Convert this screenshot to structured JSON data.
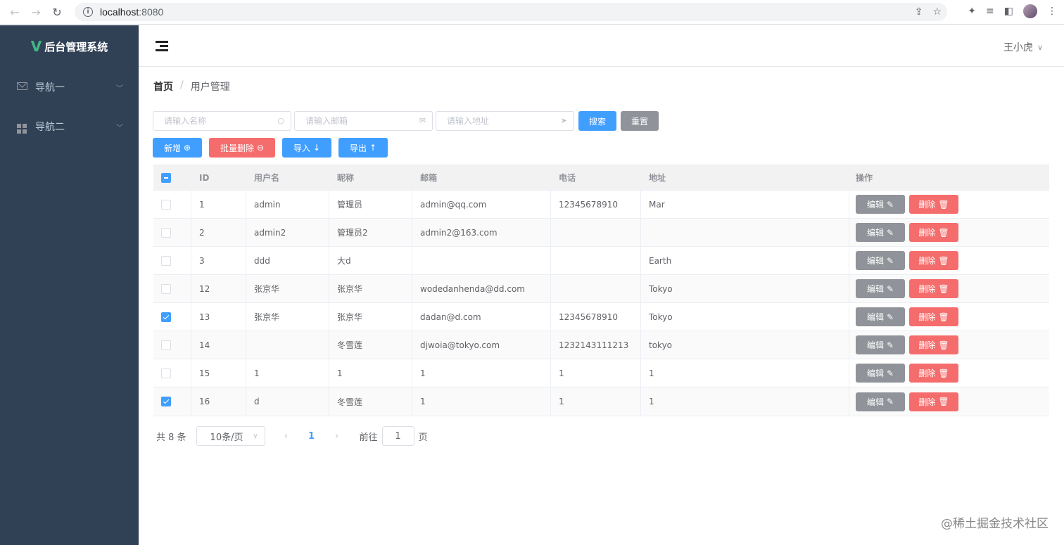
{
  "browser": {
    "url_host": "localhost",
    "url_port": ":8080"
  },
  "sidebar": {
    "logo_text": "后台管理系统",
    "items": [
      {
        "label": "导航一",
        "icon": "envelope-icon"
      },
      {
        "label": "导航二",
        "icon": "grid-icon"
      }
    ]
  },
  "header": {
    "username": "王小虎"
  },
  "breadcrumb": {
    "home": "首页",
    "separator": "/",
    "current": "用户管理"
  },
  "search": {
    "name_placeholder": "请输入名称",
    "email_placeholder": "请输入邮箱",
    "address_placeholder": "请输入地址",
    "search_label": "搜索",
    "reset_label": "重置"
  },
  "actions": {
    "add_label": "新增",
    "batch_delete_label": "批量删除",
    "import_label": "导入",
    "export_label": "导出"
  },
  "table": {
    "columns": [
      "ID",
      "用户名",
      "昵称",
      "邮箱",
      "电话",
      "地址",
      "操作"
    ],
    "edit_label": "编辑",
    "delete_label": "删除",
    "rows": [
      {
        "id": "1",
        "username": "admin",
        "nickname": "管理员",
        "email": "admin@qq.com",
        "phone": "12345678910",
        "address": "Mar",
        "checked": false
      },
      {
        "id": "2",
        "username": "admin2",
        "nickname": "管理员2",
        "email": "admin2@163.com",
        "phone": "",
        "address": "",
        "checked": false
      },
      {
        "id": "3",
        "username": "ddd",
        "nickname": "大d",
        "email": "",
        "phone": "",
        "address": "Earth",
        "checked": false
      },
      {
        "id": "12",
        "username": "张京华",
        "nickname": "张京华",
        "email": "wodedanhenda@dd.com",
        "phone": "",
        "address": "Tokyo",
        "checked": false
      },
      {
        "id": "13",
        "username": "张京华",
        "nickname": "张京华",
        "email": "dadan@d.com",
        "phone": "12345678910",
        "address": "Tokyo",
        "checked": true
      },
      {
        "id": "14",
        "username": "",
        "nickname": "冬雪莲",
        "email": "djwoia@tokyo.com",
        "phone": "1232143111213",
        "address": "tokyo",
        "checked": false
      },
      {
        "id": "15",
        "username": "1",
        "nickname": "1",
        "email": "1",
        "phone": "1",
        "address": "1",
        "checked": false
      },
      {
        "id": "16",
        "username": "d",
        "nickname": "冬雪莲",
        "email": "1",
        "phone": "1",
        "address": "1",
        "checked": true
      }
    ]
  },
  "pagination": {
    "total_text": "共 8 条",
    "page_size": "10条/页",
    "current_page": "1",
    "goto_label": "前往",
    "goto_value": "1",
    "page_suffix": "页"
  },
  "watermark": "@稀土掘金技术社区",
  "colors": {
    "primary": "#409eff",
    "danger": "#f56c6c",
    "info": "#909399",
    "sidebar_bg": "#304156",
    "logo_accent": "#41b883"
  }
}
